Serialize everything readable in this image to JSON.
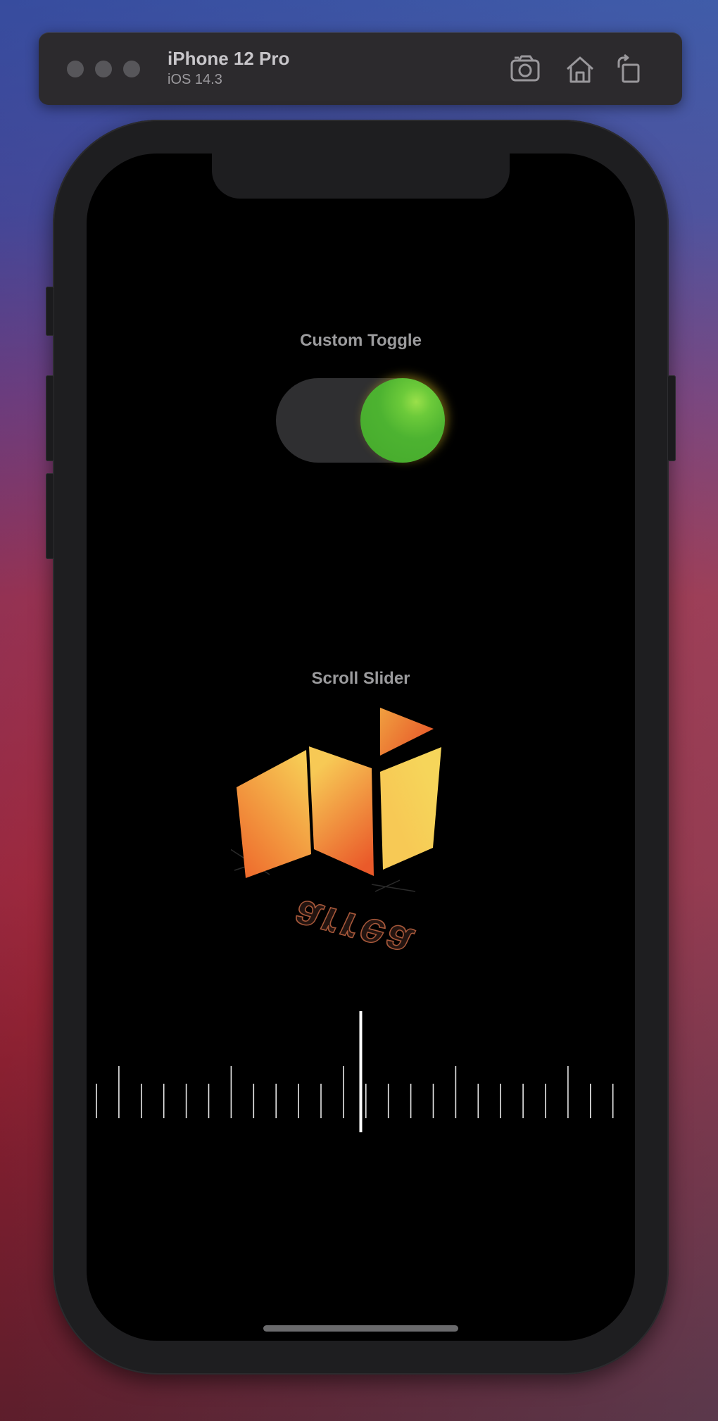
{
  "simulator": {
    "device_name": "iPhone 12 Pro",
    "os_version": "iOS 14.3",
    "toolbar_icons": [
      "screenshot-icon",
      "home-icon",
      "rotate-icon"
    ]
  },
  "app": {
    "toggle": {
      "label": "Custom Toggle",
      "state": "on",
      "knob_color": "#4db331",
      "track_color": "#2f2f31"
    },
    "slider": {
      "label": "Scroll Slider",
      "logo_text": "arrea",
      "tick_count": 24,
      "major_every": 5,
      "indicator_color": "#ffffff"
    }
  },
  "colors": {
    "logo_gradient": [
      "#f7cc55",
      "#ee6a2c"
    ]
  }
}
